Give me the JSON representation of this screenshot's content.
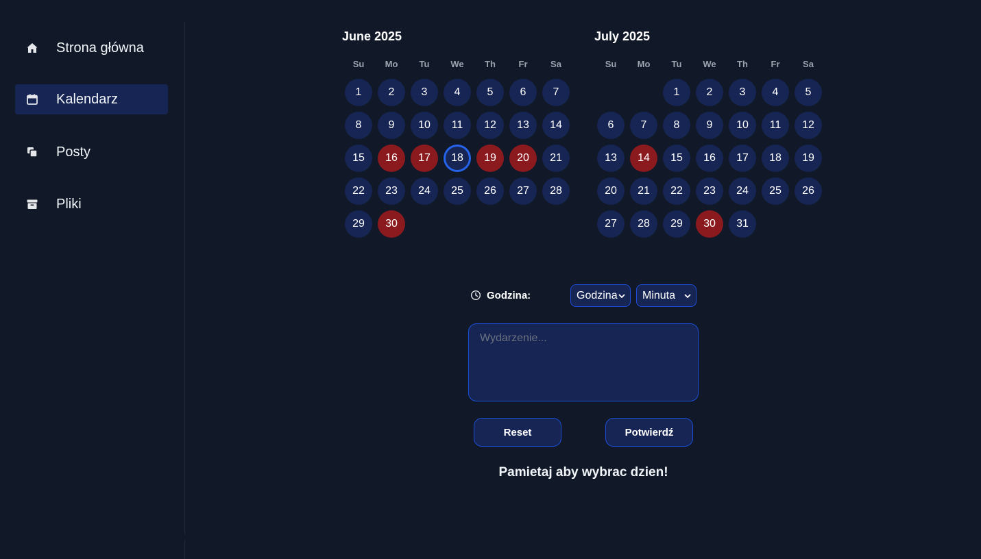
{
  "sidebar": {
    "items": [
      {
        "label": "Strona główna",
        "icon": "home-icon",
        "active": false
      },
      {
        "label": "Kalendarz",
        "icon": "calendar-icon",
        "active": true
      },
      {
        "label": "Posty",
        "icon": "copy-icon",
        "active": false
      },
      {
        "label": "Pliki",
        "icon": "archive-icon",
        "active": false
      }
    ]
  },
  "calendar": {
    "weekdays": [
      "Su",
      "Mo",
      "Tu",
      "We",
      "Th",
      "Fr",
      "Sa"
    ],
    "months": [
      {
        "title": "June 2025",
        "first_weekday": 0,
        "days": 30,
        "busy_days": [
          16,
          17,
          19,
          20,
          30
        ],
        "selected_day": 18
      },
      {
        "title": "July 2025",
        "first_weekday": 2,
        "days": 31,
        "busy_days": [
          14,
          30
        ],
        "selected_day": null
      }
    ],
    "colors": {
      "day": "#172554",
      "busy": "#8b1a1f",
      "selected_ring": "#2563eb"
    }
  },
  "time": {
    "label": "Godzina:",
    "hour_select": "Godzina",
    "minute_select": "Minuta"
  },
  "event": {
    "placeholder": "Wydarzenie..."
  },
  "buttons": {
    "reset": "Reset",
    "confirm": "Potwierdź"
  },
  "reminder": "Pamietaj aby wybrac dzien!"
}
